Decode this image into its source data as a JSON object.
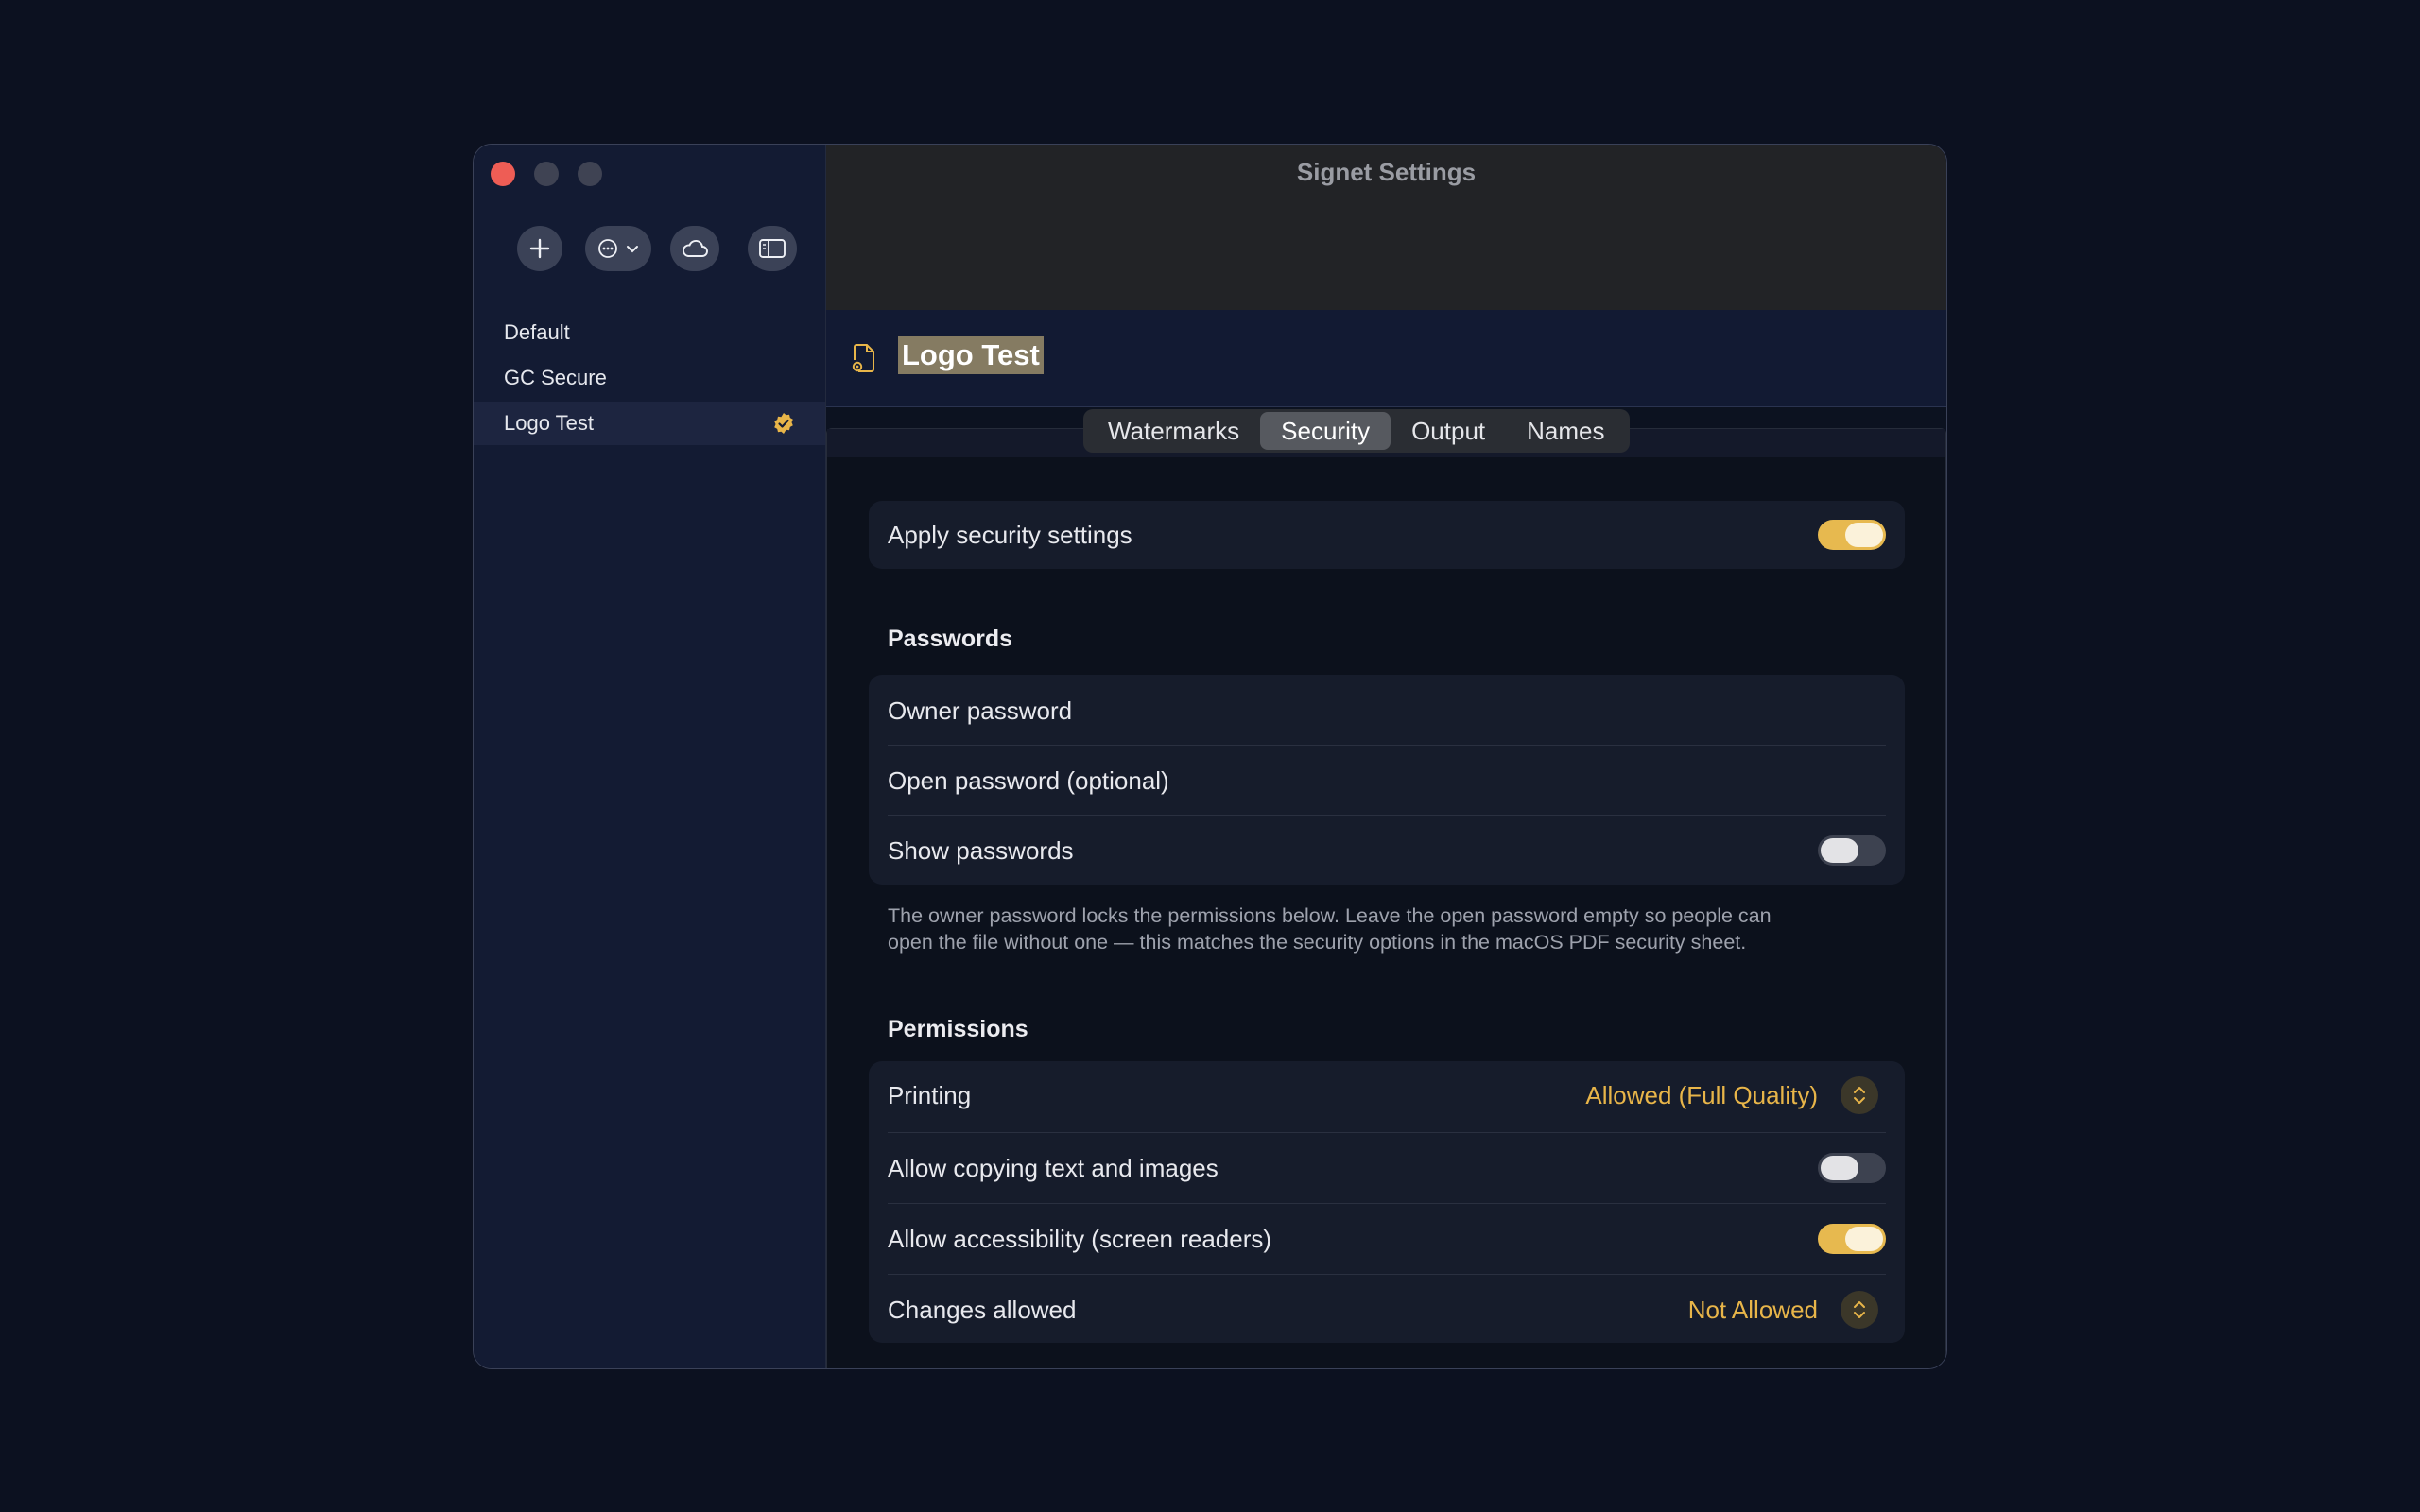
{
  "window": {
    "title": "Signet Settings"
  },
  "toolbar": {
    "add_icon": "plus-icon",
    "more_icon": "ellipsis-circle-icon",
    "cloud_icon": "cloud-icon",
    "sidebar_icon": "sidebar-toggle-icon"
  },
  "sidebar": {
    "items": [
      {
        "label": "Default"
      },
      {
        "label": "GC Secure"
      },
      {
        "label": "Logo Test",
        "badge_icon": "checkmark-seal-icon"
      }
    ],
    "selected": "Logo Test"
  },
  "profile": {
    "name": "Logo Test",
    "icon": "document-gear-icon"
  },
  "tabs": [
    {
      "label": "Watermarks"
    },
    {
      "label": "Security"
    },
    {
      "label": "Output"
    },
    {
      "label": "Names"
    }
  ],
  "active_tab": "Security",
  "security": {
    "apply_label": "Apply security settings",
    "apply_on": true,
    "passwords_title": "Passwords",
    "owner_password_label": "Owner password",
    "open_password_label": "Open password (optional)",
    "show_passwords_label": "Show passwords",
    "show_passwords_on": false,
    "note_line1": "The owner password locks the permissions below. Leave the open password empty so people can",
    "note_line2": "open the file without one — this matches the security options in the macOS PDF security sheet.",
    "permissions_title": "Permissions",
    "printing_label": "Printing",
    "printing_value": "Allowed (Full Quality)",
    "copying_label": "Allow copying text and images",
    "copying_on": false,
    "accessibility_label": "Allow accessibility (screen readers)",
    "accessibility_on": true,
    "changes_label": "Changes allowed",
    "changes_value": "Not Allowed"
  },
  "colors": {
    "accent": "#e8b549",
    "toggle_on": "#e7b94f",
    "close": "#ee5d55"
  }
}
